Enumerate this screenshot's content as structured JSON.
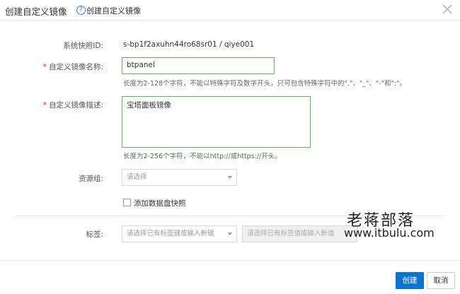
{
  "dialog": {
    "title": "创建自定义镜像",
    "help_label": "创建自定义镜像",
    "close_glyph": "✕"
  },
  "form": {
    "snapshot_id": {
      "label": "系统快照ID:",
      "value": "s-bp1f2axuhn44ro68sr01 /  qiye001"
    },
    "image_name": {
      "required_mark": "*",
      "label": "自定义镜像名称:",
      "value": "btpanel",
      "hint": "长度为2-128个字符，不能以特殊字符及数字开头，只可包含特殊字符中的\".\"、\"_\"、\"-\"和\":\"。"
    },
    "image_desc": {
      "required_mark": "*",
      "label": "自定义镜像描述:",
      "value": "宝塔面板镜像",
      "hint": "长度为2-256个字符，不能以http://或https://开头。"
    },
    "resource_group": {
      "label": "资源组:",
      "placeholder": "请选择"
    },
    "data_disk": {
      "label": "添加数据盘快照",
      "checked": false
    },
    "tags": {
      "label": "标签:",
      "key_placeholder": "请选择已有标签键或输入新键",
      "value_placeholder": "请选择已有标签值或输入新值"
    }
  },
  "watermark": {
    "line1": "老蒋部落",
    "line2": "www.itbulu.com"
  },
  "footer": {
    "create_label": "创建",
    "cancel_label": "取消"
  },
  "colors": {
    "primary": "#0d73d1",
    "valid_border": "#57b957",
    "required": "#e22222"
  }
}
